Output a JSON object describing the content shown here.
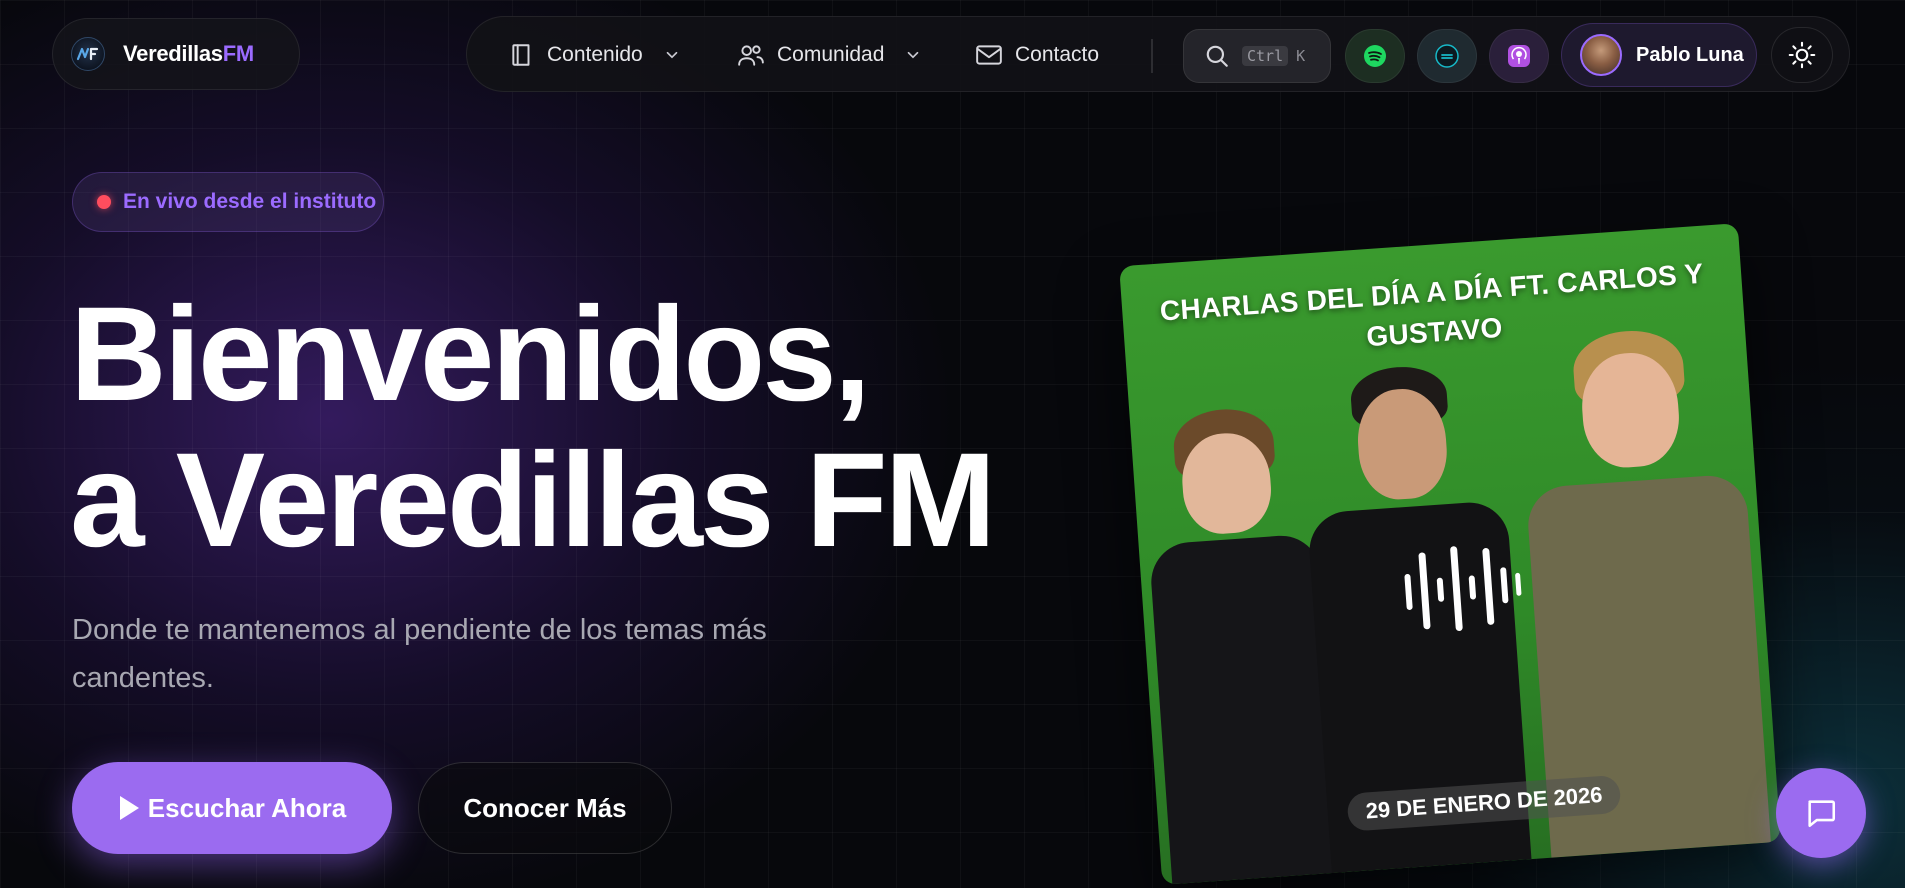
{
  "brand": {
    "name_main": "Veredillas",
    "name_accent": "FM"
  },
  "nav": {
    "items": [
      {
        "label": "Contenido",
        "icon": "book-icon",
        "has_dropdown": true
      },
      {
        "label": "Comunidad",
        "icon": "users-icon",
        "has_dropdown": true
      },
      {
        "label": "Contacto",
        "icon": "mail-icon",
        "has_dropdown": false
      }
    ],
    "search": {
      "shortcut_key1": "Ctrl",
      "shortcut_key2": "K",
      "icon": "search-icon"
    },
    "platforms": [
      {
        "name": "spotify-icon",
        "bg": "#1d2e22",
        "color": "#1ed760"
      },
      {
        "name": "ivoox-icon",
        "bg": "#1f2a30",
        "color": "#17b9c8"
      },
      {
        "name": "apple-podcasts-icon",
        "bg": "#2a1f3a",
        "color": "#b150e2"
      }
    ],
    "profile": {
      "name": "Pablo Luna"
    },
    "theme_icon": "sun-icon"
  },
  "hero": {
    "badge": "En vivo desde el instituto",
    "title_line1": "Bienvenidos,",
    "title_line2": "a Veredillas FM",
    "subtitle": "Donde te mantenemos al pendiente de los temas más candentes.",
    "primary_button": "Escuchar Ahora",
    "secondary_button": "Conocer Más"
  },
  "card": {
    "title": "CHARLAS DEL DÍA A DÍA FT. CARLOS Y GUSTAVO",
    "date": "29 DE ENERO DE 2026"
  },
  "colors": {
    "accent": "#9b6bff",
    "live": "#ff4d5e",
    "card_green": "#3a9a2e"
  }
}
